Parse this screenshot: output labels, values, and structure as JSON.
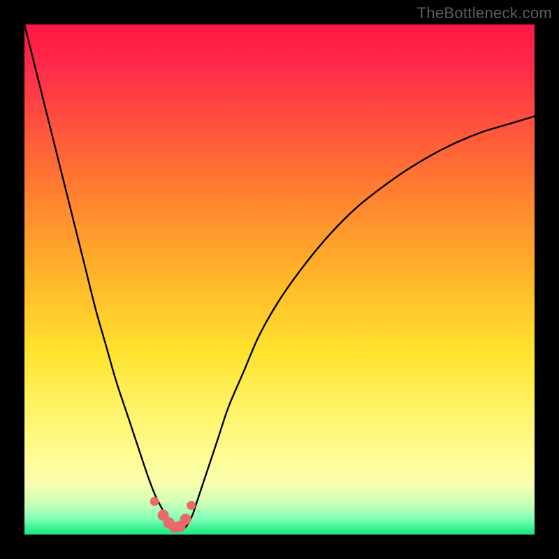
{
  "watermark": "TheBottleneck.com",
  "colors": {
    "frame": "#000000",
    "curve": "#000000",
    "marker_fill": "#e86a6a",
    "marker_stroke": "#cc4a4a",
    "gradient_top": "#ff1744",
    "gradient_bottom": "#19e884"
  },
  "chart_data": {
    "type": "line",
    "title": "",
    "xlabel": "",
    "ylabel": "",
    "xlim": [
      0,
      100
    ],
    "ylim": [
      0,
      100
    ],
    "x": [
      0,
      2,
      4,
      6,
      8,
      10,
      12,
      14,
      16,
      18,
      20,
      22,
      24,
      25.5,
      27,
      28,
      29,
      30,
      31,
      32,
      33,
      34,
      36,
      38,
      40,
      43,
      46,
      50,
      55,
      60,
      65,
      70,
      75,
      80,
      85,
      90,
      95,
      100
    ],
    "y": [
      100,
      92,
      84,
      76,
      68,
      60,
      52,
      44,
      37,
      30,
      24,
      18,
      12,
      8,
      5,
      3,
      2,
      1,
      1,
      2,
      4,
      7,
      13,
      19,
      25,
      32,
      39,
      46,
      53,
      59,
      64,
      68,
      71.5,
      74.5,
      77,
      79,
      80.5,
      82
    ],
    "curve_note": "Two branches form a V with minimum near x≈29–30; right branch rises concavely toward ~82% at x=100.",
    "markers": {
      "x": [
        25.5,
        27.2,
        28.3,
        29.4,
        30.5,
        31.6,
        32.7
      ],
      "y": [
        6.5,
        3.8,
        2.3,
        1.4,
        1.6,
        3.0,
        5.7
      ]
    },
    "legend": null,
    "grid": false
  }
}
